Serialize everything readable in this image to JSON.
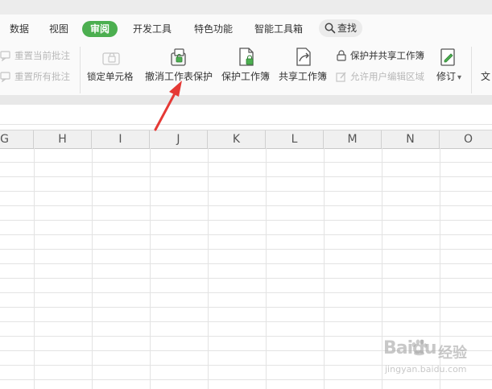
{
  "menu": {
    "tabs": [
      {
        "label": "数据"
      },
      {
        "label": "视图"
      },
      {
        "label": "审阅",
        "active": true
      },
      {
        "label": "开发工具"
      },
      {
        "label": "特色功能"
      },
      {
        "label": "智能工具箱"
      }
    ],
    "search_label": "查找"
  },
  "ribbon": {
    "comments": {
      "reset_current": "重置当前批注",
      "reset_all": "重置所有批注"
    },
    "lock_cell": "锁定单元格",
    "unprotect_sheet": "撤消工作表保护",
    "protect_workbook": "保护工作簿",
    "share_workbook": "共享工作簿",
    "protect_and_share": "保护并共享工作簿",
    "allow_edit_ranges": "允许用户编辑区域",
    "track_changes": "修订",
    "track_changes_arrow": "▾",
    "doc_partial": "文"
  },
  "columns": [
    "G",
    "H",
    "I",
    "J",
    "K",
    "L",
    "M",
    "N",
    "O"
  ],
  "watermark": {
    "brand": "Baidu",
    "suffix": "经验",
    "url": "jingyan.baidu.com"
  },
  "colors": {
    "accent": "#4caf50",
    "arrow": "#e53935",
    "grid": "#e3e3e3",
    "header_bg": "#f0f0f0"
  }
}
